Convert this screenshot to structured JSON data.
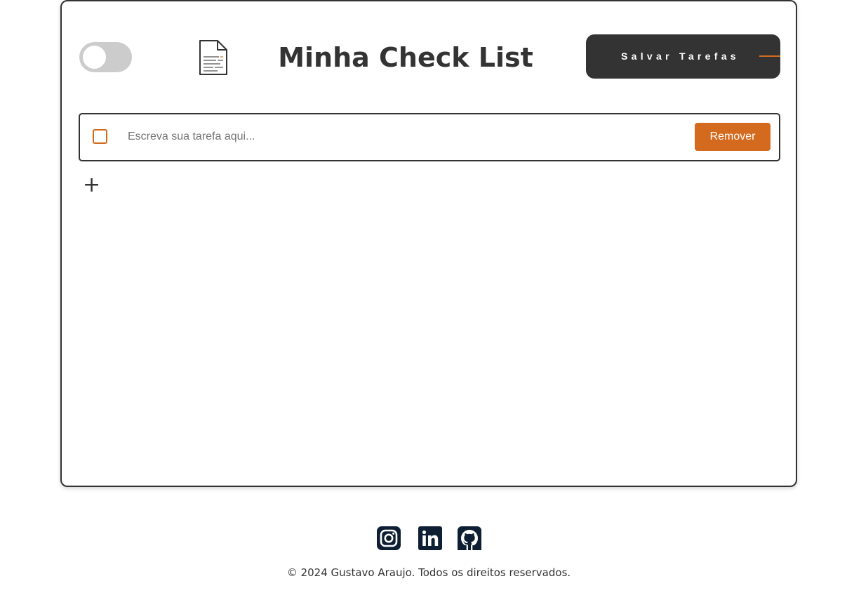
{
  "header": {
    "title": "Minha Check List",
    "save_label": "Salvar Tarefas",
    "theme_toggle": {
      "state": "off"
    },
    "logo_icon": "document-icon"
  },
  "tasks": [
    {
      "checked": false,
      "value": "",
      "placeholder": "Escreva sua tarefa aqui...",
      "remove_label": "Remover"
    }
  ],
  "add_task_label": "+",
  "footer": {
    "social_icons": [
      "instagram-icon",
      "linkedin-icon",
      "github-icon"
    ],
    "copyright": "© 2024 Gustavo Araujo. Todos os direitos reservados."
  },
  "colors": {
    "accent": "#d46a1e",
    "dark": "#333333",
    "toggle_track": "#cccccc",
    "social_icon": "#0e1f33"
  }
}
